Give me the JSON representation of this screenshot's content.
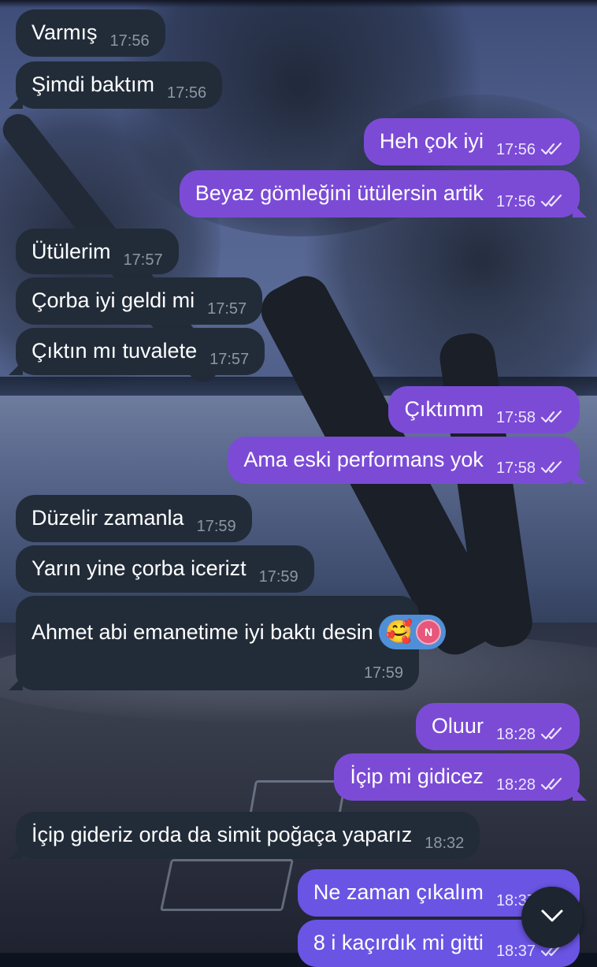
{
  "messages": [
    {
      "text": "Varmış",
      "time": "17:56",
      "dir": "in"
    },
    {
      "text": "Şimdi baktım",
      "time": "17:56",
      "dir": "in"
    },
    {
      "text": "Heh çok iyi",
      "time": "17:56",
      "dir": "out"
    },
    {
      "text": "Beyaz gömleğini ütülersin artik",
      "time": "17:56",
      "dir": "out"
    },
    {
      "text": "Ütülerim",
      "time": "17:57",
      "dir": "in"
    },
    {
      "text": "Çorba iyi geldi mi",
      "time": "17:57",
      "dir": "in"
    },
    {
      "text": "Çıktın mı tuvalete",
      "time": "17:57",
      "dir": "in"
    },
    {
      "text": "Çıktımm",
      "time": "17:58",
      "dir": "out"
    },
    {
      "text": "Ama eski performans yok",
      "time": "17:58",
      "dir": "out"
    },
    {
      "text": "Düzelir zamanla",
      "time": "17:59",
      "dir": "in"
    },
    {
      "text": "Yarın yine çorba icerizt",
      "time": "17:59",
      "dir": "in"
    },
    {
      "text": "Ahmet abi emanetime iyi baktı desin",
      "time": "17:59",
      "dir": "in",
      "reaction": {
        "emoji": "🥰",
        "avatar_initial": "N"
      }
    },
    {
      "text": "Oluur",
      "time": "18:28",
      "dir": "out"
    },
    {
      "text": "İçip mi gidicez",
      "time": "18:28",
      "dir": "out"
    },
    {
      "text": "İçip gideriz orda da simit poğaça yaparız",
      "time": "18:32",
      "dir": "in"
    },
    {
      "text": "Ne zaman çıkalım",
      "time": "18:37",
      "dir": "out"
    },
    {
      "text": "8 i kaçırdık mi gitti",
      "time": "18:37",
      "dir": "out"
    }
  ],
  "icons": {
    "read_receipt": "double-check-icon",
    "scroll_down": "chevron-down-icon"
  },
  "colors": {
    "incoming": "#222c39",
    "outgoing": "#7b4bd6",
    "reaction": "#4f8fd8"
  }
}
